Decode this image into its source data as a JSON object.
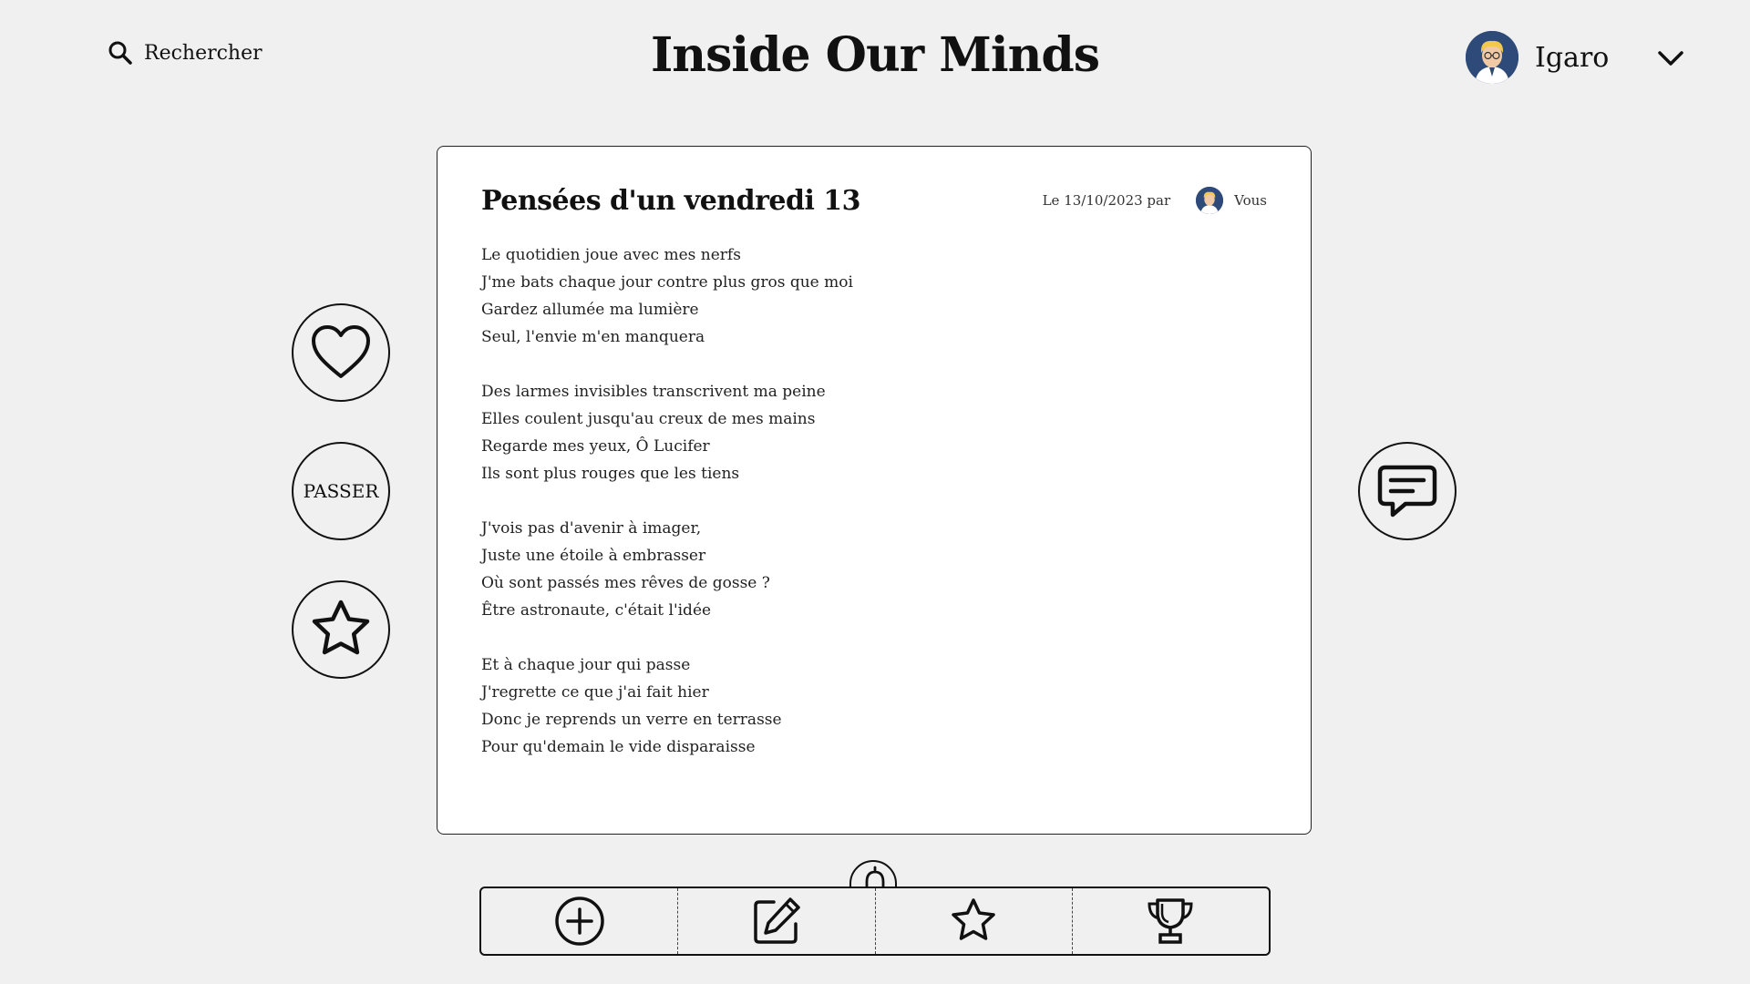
{
  "header": {
    "search_label": "Rechercher",
    "site_title": "Inside Our Minds",
    "user_name": "Igaro"
  },
  "post": {
    "title": "Pensées d'un vendredi 13",
    "date_text": "Le 13/10/2023 par",
    "author": "Vous",
    "stanzas": [
      [
        "Le quotidien joue avec mes nerfs",
        "J'me bats chaque jour contre plus gros que moi",
        "Gardez allumée ma lumière",
        "Seul, l'envie m'en manquera"
      ],
      [
        "Des larmes invisibles transcrivent ma peine",
        "Elles coulent jusqu'au creux de mes mains",
        "Regarde mes yeux, Ô Lucifer",
        "Ils sont plus rouges que les tiens"
      ],
      [
        "J'vois pas d'avenir à imager,",
        "Juste une étoile à embrasser",
        "Où sont passés mes rêves de gosse ?",
        "Être astronaute, c'était l'idée"
      ],
      [
        "Et à chaque jour qui passe",
        "J'regrette ce que j'ai fait hier",
        "Donc je reprends un verre en terrasse",
        "Pour qu'demain le vide disparaisse"
      ]
    ]
  },
  "actions": {
    "pass_label": "PASSER"
  },
  "icons": [
    "search-icon",
    "chevron-down-icon",
    "heart-icon",
    "star-icon",
    "comment-icon",
    "plus-circle-icon",
    "edit-icon",
    "trophy-icon",
    "bell-icon"
  ]
}
